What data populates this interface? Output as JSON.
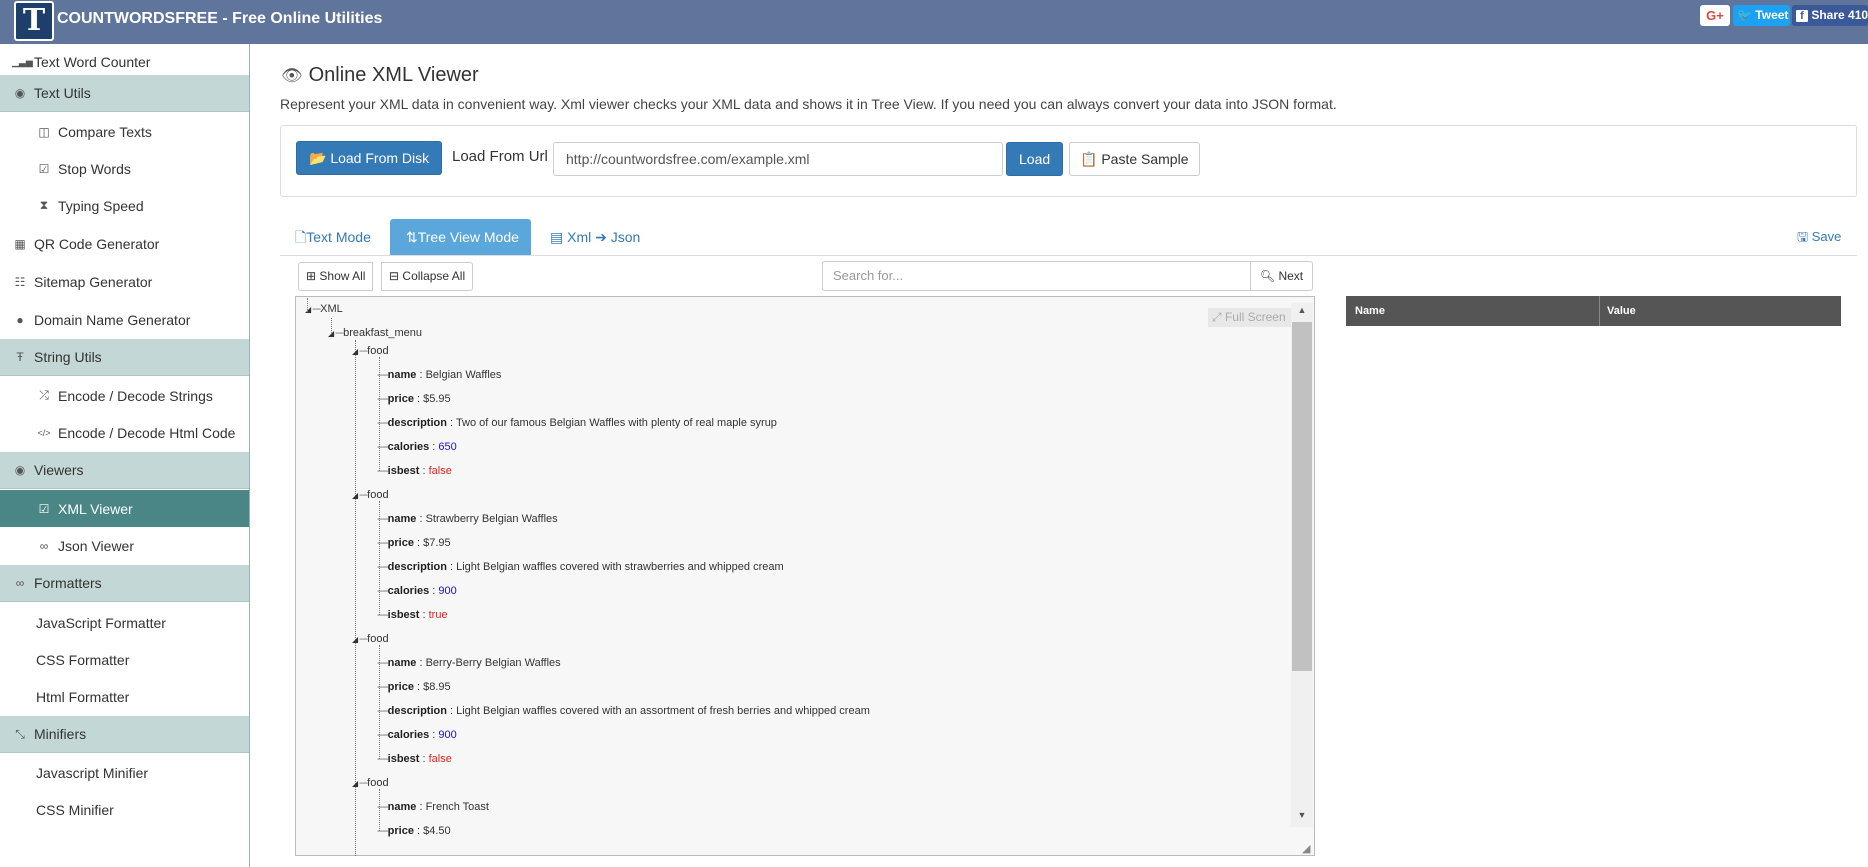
{
  "header": {
    "logo_letter": "T",
    "brand": "COUNTWORDSFREE - Free Online Utilities",
    "gplus": "G+",
    "tweet": "Tweet",
    "share": "Share 410"
  },
  "sidebar": {
    "items": [
      {
        "label": "Text Word Counter",
        "icon": "bar-chart-icon",
        "kind": "top"
      },
      {
        "label": "Text Utils",
        "icon": "eye-icon",
        "kind": "group"
      },
      {
        "label": "Compare Texts",
        "icon": "columns-icon",
        "kind": "sub"
      },
      {
        "label": "Stop Words",
        "icon": "check-square-icon",
        "kind": "sub"
      },
      {
        "label": "Typing Speed",
        "icon": "hourglass-icon",
        "kind": "sub"
      },
      {
        "label": "QR Code Generator",
        "icon": "qrcode-icon",
        "kind": "top"
      },
      {
        "label": "Sitemap Generator",
        "icon": "sitemap-icon",
        "kind": "top"
      },
      {
        "label": "Domain Name Generator",
        "icon": "globe-icon",
        "kind": "top"
      },
      {
        "label": "String Utils",
        "icon": "text-cursor-icon",
        "kind": "group"
      },
      {
        "label": "Encode / Decode Strings",
        "icon": "shuffle-icon",
        "kind": "sub"
      },
      {
        "label": "Encode / Decode Html Code",
        "icon": "code-icon",
        "kind": "sub"
      },
      {
        "label": "Viewers",
        "icon": "eye-icon",
        "kind": "group"
      },
      {
        "label": "XML Viewer",
        "icon": "check-square-icon",
        "kind": "active"
      },
      {
        "label": "Json Viewer",
        "icon": "link-icon",
        "kind": "sub"
      },
      {
        "label": "Formatters",
        "icon": "link-icon",
        "kind": "group"
      },
      {
        "label": "JavaScript Formatter",
        "icon": "",
        "kind": "plain"
      },
      {
        "label": "CSS Formatter",
        "icon": "",
        "kind": "plain"
      },
      {
        "label": "Html Formatter",
        "icon": "",
        "kind": "plain"
      },
      {
        "label": "Minifiers",
        "icon": "compress-icon",
        "kind": "group"
      },
      {
        "label": "Javascript Minifier",
        "icon": "",
        "kind": "plain"
      },
      {
        "label": "CSS Minifier",
        "icon": "",
        "kind": "plain"
      }
    ]
  },
  "main": {
    "title": "Online XML Viewer",
    "description": "Represent your XML data in convenient way. Xml viewer checks your XML data and shows it in Tree View. If you need you can always convert your data into JSON format.",
    "load_from_disk": "Load From Disk",
    "load_from_url_label": "Load From Url",
    "url_value": "http://countwordsfree.com/example.xml",
    "load_button": "Load",
    "paste_sample": "Paste Sample",
    "tabs": {
      "text_mode": "Text Mode",
      "tree_view_mode": "Tree View Mode",
      "xml_json_left": "Xml",
      "xml_json_right": "Json"
    },
    "save": "Save",
    "show_all": "Show All",
    "collapse_all": "Collapse All",
    "search_placeholder": "Search for...",
    "next": "Next",
    "full_screen": "Full Screen",
    "props": {
      "name": "Name",
      "value": "Value"
    }
  },
  "tree": {
    "root": "XML",
    "menu": "breakfast_menu",
    "foods": [
      {
        "label": "food",
        "fields": [
          {
            "key": "name",
            "value": "Belgian Waffles",
            "type": "str"
          },
          {
            "key": "price",
            "value": "$5.95",
            "type": "str"
          },
          {
            "key": "description",
            "value": "Two of our famous Belgian Waffles with plenty of real maple syrup",
            "type": "str"
          },
          {
            "key": "calories",
            "value": "650",
            "type": "num"
          },
          {
            "key": "isbest",
            "value": "false",
            "type": "bool"
          }
        ]
      },
      {
        "label": "food",
        "fields": [
          {
            "key": "name",
            "value": "Strawberry Belgian Waffles",
            "type": "str"
          },
          {
            "key": "price",
            "value": "$7.95",
            "type": "str"
          },
          {
            "key": "description",
            "value": "Light Belgian waffles covered with strawberries and whipped cream",
            "type": "str"
          },
          {
            "key": "calories",
            "value": "900",
            "type": "num"
          },
          {
            "key": "isbest",
            "value": "true",
            "type": "bool"
          }
        ]
      },
      {
        "label": "food",
        "fields": [
          {
            "key": "name",
            "value": "Berry-Berry Belgian Waffles",
            "type": "str"
          },
          {
            "key": "price",
            "value": "$8.95",
            "type": "str"
          },
          {
            "key": "description",
            "value": "Light Belgian waffles covered with an assortment of fresh berries and whipped cream",
            "type": "str"
          },
          {
            "key": "calories",
            "value": "900",
            "type": "num"
          },
          {
            "key": "isbest",
            "value": "false",
            "type": "bool"
          }
        ]
      },
      {
        "label": "food",
        "fields": [
          {
            "key": "name",
            "value": "French Toast",
            "type": "str"
          },
          {
            "key": "price",
            "value": "$4.50",
            "type": "str"
          }
        ]
      }
    ]
  },
  "colors": {
    "topbar": "#5f759b",
    "sidebar_group": "#c3d7d7",
    "sidebar_active": "#4a8686",
    "primary": "#337ab7",
    "tab_active": "#5ba7dc",
    "number": "#1414d9",
    "boolean": "#e02020"
  }
}
